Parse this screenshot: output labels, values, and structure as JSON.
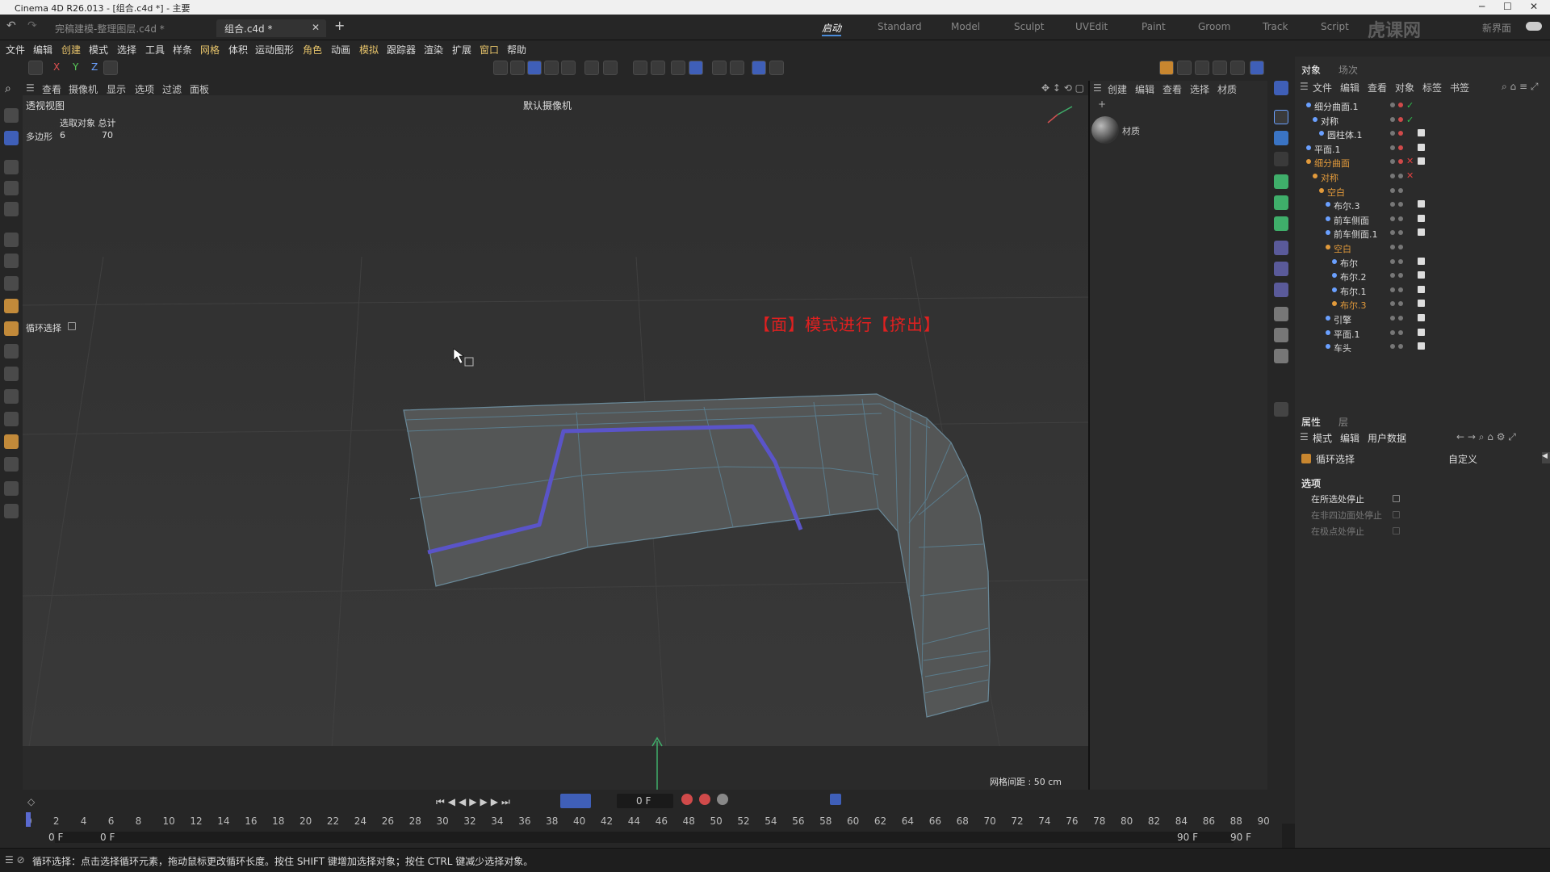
{
  "window": {
    "title": "Cinema 4D R26.013 - [组合.c4d *] - 主要",
    "logo_text": "虎课网"
  },
  "tabs": [
    {
      "label": "完稿建模-整理图层.c4d *"
    },
    {
      "label": "组合.c4d *"
    }
  ],
  "layouts": [
    "启动",
    "Standard",
    "Model",
    "Sculpt",
    "UVEdit",
    "Paint",
    "Groom",
    "Track",
    "Script",
    "新界面"
  ],
  "menus": [
    "文件",
    "编辑",
    "创建",
    "模式",
    "选择",
    "工具",
    "样条",
    "网格",
    "体积",
    "运动图形",
    "角色",
    "动画",
    "模拟",
    "跟踪器",
    "渲染",
    "扩展",
    "窗口",
    "帮助"
  ],
  "axes": [
    "X",
    "Y",
    "Z"
  ],
  "viewport_menu": [
    "查看",
    "摄像机",
    "显示",
    "选项",
    "过滤",
    "面板"
  ],
  "viewport": {
    "name": "透视视图",
    "camera": "默认摄像机",
    "stats_header": "选取对象 总计",
    "stats_label": "多边形",
    "stats_selected": "6",
    "stats_total": "70",
    "tool_label": "循环选择",
    "annotation": "【面】模式进行【挤出】",
    "grid_spacing": "网格间距 : 50 cm"
  },
  "material_panel": {
    "menu": [
      "创建",
      "编辑",
      "查看",
      "选择",
      "材质"
    ],
    "material_name": "材质"
  },
  "object_panel": {
    "tabs": [
      "对象",
      "场次"
    ],
    "menu": [
      "文件",
      "编辑",
      "查看",
      "对象",
      "标签",
      "书签"
    ],
    "rows": [
      {
        "name": "细分曲面.1",
        "indent": 0,
        "orange": false,
        "state": "check"
      },
      {
        "name": "对称",
        "indent": 1,
        "orange": false,
        "state": "check"
      },
      {
        "name": "圆柱体.1",
        "indent": 2,
        "orange": false,
        "state": ""
      },
      {
        "name": "平面.1",
        "indent": 0,
        "orange": false,
        "state": ""
      },
      {
        "name": "细分曲面",
        "indent": 0,
        "orange": true,
        "state": "cross"
      },
      {
        "name": "对称",
        "indent": 1,
        "orange": true,
        "state": "cross"
      },
      {
        "name": "空白",
        "indent": 2,
        "orange": true,
        "state": ""
      },
      {
        "name": "布尔.3",
        "indent": 3,
        "orange": false,
        "state": ""
      },
      {
        "name": "前车侧面",
        "indent": 3,
        "orange": false,
        "state": ""
      },
      {
        "name": "前车侧面.1",
        "indent": 3,
        "orange": false,
        "state": ""
      },
      {
        "name": "空白",
        "indent": 3,
        "orange": true,
        "state": ""
      },
      {
        "name": "布尔",
        "indent": 4,
        "orange": false,
        "state": ""
      },
      {
        "name": "布尔.2",
        "indent": 4,
        "orange": false,
        "state": ""
      },
      {
        "name": "布尔.1",
        "indent": 4,
        "orange": false,
        "state": ""
      },
      {
        "name": "布尔.3",
        "indent": 4,
        "orange": true,
        "state": ""
      },
      {
        "name": "引擎",
        "indent": 3,
        "orange": false,
        "state": ""
      },
      {
        "name": "平面.1",
        "indent": 3,
        "orange": false,
        "state": ""
      },
      {
        "name": "车头",
        "indent": 3,
        "orange": false,
        "state": ""
      }
    ]
  },
  "attr_panel": {
    "tabs": [
      "属性",
      "层"
    ],
    "menu": [
      "模式",
      "编辑",
      "用户数据"
    ],
    "tool_name": "循环选择",
    "preset": "自定义",
    "section": "选项",
    "options": [
      "在所选处停止",
      "在非四边面处停止",
      "在极点处停止"
    ]
  },
  "timeline": {
    "current_frame": "0 F",
    "ticks": [
      "0",
      "2",
      "4",
      "6",
      "8",
      "10",
      "12",
      "14",
      "16",
      "18",
      "20",
      "22",
      "24",
      "26",
      "28",
      "30",
      "32",
      "34",
      "36",
      "38",
      "40",
      "42",
      "44",
      "46",
      "48",
      "50",
      "52",
      "54",
      "56",
      "58",
      "60",
      "62",
      "64",
      "66",
      "68",
      "70",
      "72",
      "74",
      "76",
      "78",
      "80",
      "82",
      "84",
      "86",
      "88",
      "90"
    ],
    "start": "0 F",
    "start2": "0 F",
    "end": "90 F",
    "end2": "90 F"
  },
  "status": "循环选择：点击选择循环元素，拖动鼠标更改循环长度。按住 SHIFT 键增加选择对象；按住 CTRL 键减少选择对象。",
  "colors": {
    "accent": "#4a8bd8",
    "selection_edge": "#5a54c8",
    "annotation": "#e02020",
    "orange_item": "#e29a3b"
  }
}
